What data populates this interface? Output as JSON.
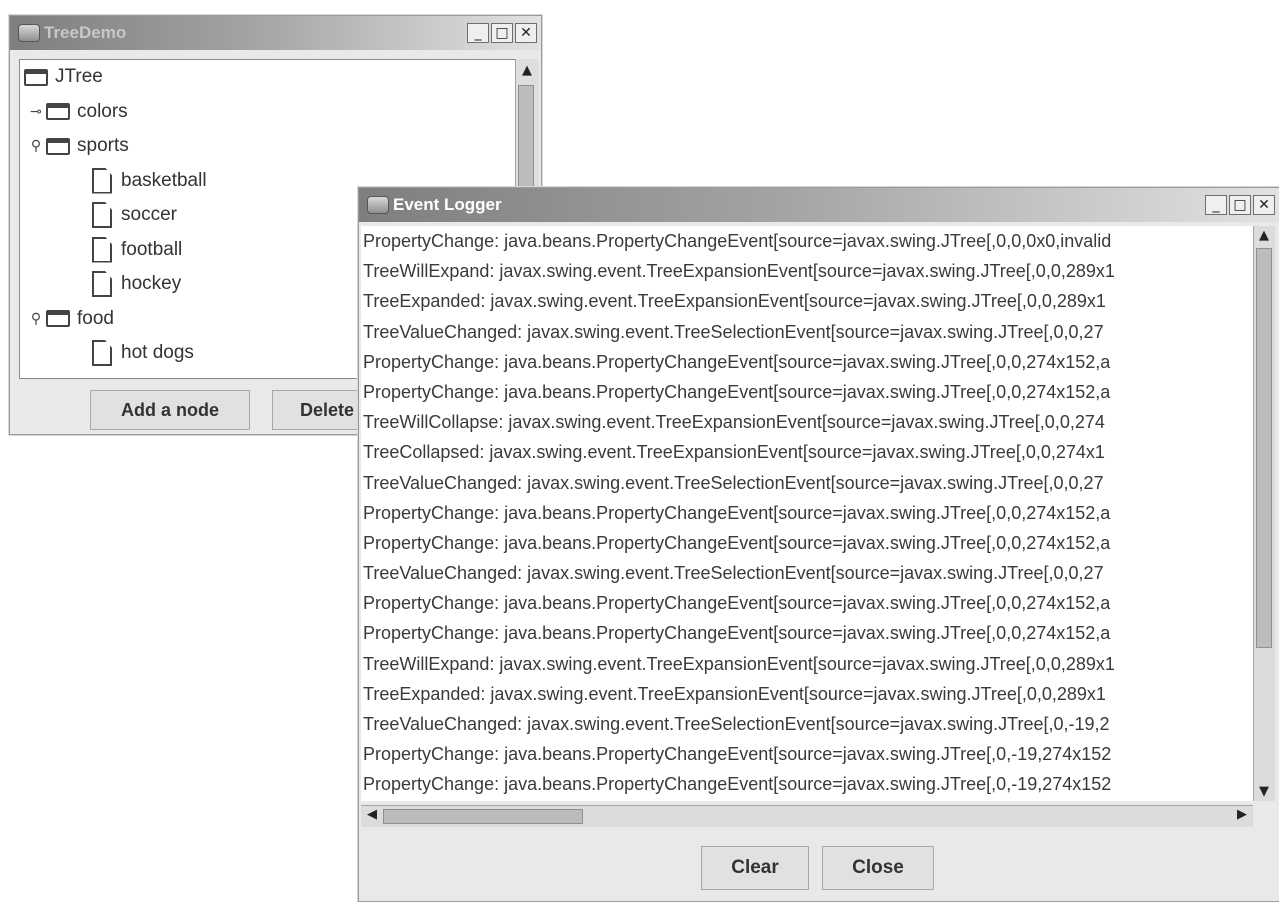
{
  "tree_window": {
    "title": "TreeDemo",
    "controls": {
      "minimize": "_",
      "maximize": "□",
      "close": "✕"
    },
    "tree": [
      {
        "label": "JTree",
        "icon": "folder-icon",
        "depth": 0,
        "handle": ""
      },
      {
        "label": "colors",
        "icon": "folder-icon",
        "depth": 1,
        "handle": "collapsed"
      },
      {
        "label": "sports",
        "icon": "folder-icon",
        "depth": 1,
        "handle": "expanded"
      },
      {
        "label": "basketball",
        "icon": "leaf-icon",
        "depth": 2,
        "handle": ""
      },
      {
        "label": "soccer",
        "icon": "leaf-icon",
        "depth": 2,
        "handle": ""
      },
      {
        "label": "football",
        "icon": "leaf-icon",
        "depth": 2,
        "handle": ""
      },
      {
        "label": "hockey",
        "icon": "leaf-icon",
        "depth": 2,
        "handle": ""
      },
      {
        "label": "food",
        "icon": "folder-icon",
        "depth": 1,
        "handle": "expanded"
      },
      {
        "label": "hot dogs",
        "icon": "leaf-icon",
        "depth": 2,
        "handle": ""
      }
    ],
    "buttons": {
      "add": "Add a node",
      "delete": "Delete"
    }
  },
  "logger_window": {
    "title": "Event Logger",
    "controls": {
      "minimize": "_",
      "maximize": "□",
      "close": "✕"
    },
    "lines": [
      "PropertyChange: java.beans.PropertyChangeEvent[source=javax.swing.JTree[,0,0,0x0,invalid",
      "TreeWillExpand: javax.swing.event.TreeExpansionEvent[source=javax.swing.JTree[,0,0,289x1",
      "TreeExpanded: javax.swing.event.TreeExpansionEvent[source=javax.swing.JTree[,0,0,289x1",
      "TreeValueChanged: javax.swing.event.TreeSelectionEvent[source=javax.swing.JTree[,0,0,27",
      "PropertyChange: java.beans.PropertyChangeEvent[source=javax.swing.JTree[,0,0,274x152,a",
      "PropertyChange: java.beans.PropertyChangeEvent[source=javax.swing.JTree[,0,0,274x152,a",
      "TreeWillCollapse: javax.swing.event.TreeExpansionEvent[source=javax.swing.JTree[,0,0,274",
      "TreeCollapsed: javax.swing.event.TreeExpansionEvent[source=javax.swing.JTree[,0,0,274x1",
      "TreeValueChanged: javax.swing.event.TreeSelectionEvent[source=javax.swing.JTree[,0,0,27",
      "PropertyChange: java.beans.PropertyChangeEvent[source=javax.swing.JTree[,0,0,274x152,a",
      "PropertyChange: java.beans.PropertyChangeEvent[source=javax.swing.JTree[,0,0,274x152,a",
      "TreeValueChanged: javax.swing.event.TreeSelectionEvent[source=javax.swing.JTree[,0,0,27",
      "PropertyChange: java.beans.PropertyChangeEvent[source=javax.swing.JTree[,0,0,274x152,a",
      "PropertyChange: java.beans.PropertyChangeEvent[source=javax.swing.JTree[,0,0,274x152,a",
      "TreeWillExpand: javax.swing.event.TreeExpansionEvent[source=javax.swing.JTree[,0,0,289x1",
      "TreeExpanded: javax.swing.event.TreeExpansionEvent[source=javax.swing.JTree[,0,0,289x1",
      "TreeValueChanged: javax.swing.event.TreeSelectionEvent[source=javax.swing.JTree[,0,-19,2",
      "PropertyChange: java.beans.PropertyChangeEvent[source=javax.swing.JTree[,0,-19,274x152",
      "PropertyChange: java.beans.PropertyChangeEvent[source=javax.swing.JTree[,0,-19,274x152"
    ],
    "scroll": {
      "up": "▲",
      "down": "▼",
      "left": "◀",
      "right": "▶"
    },
    "buttons": {
      "clear": "Clear",
      "close": "Close"
    }
  }
}
